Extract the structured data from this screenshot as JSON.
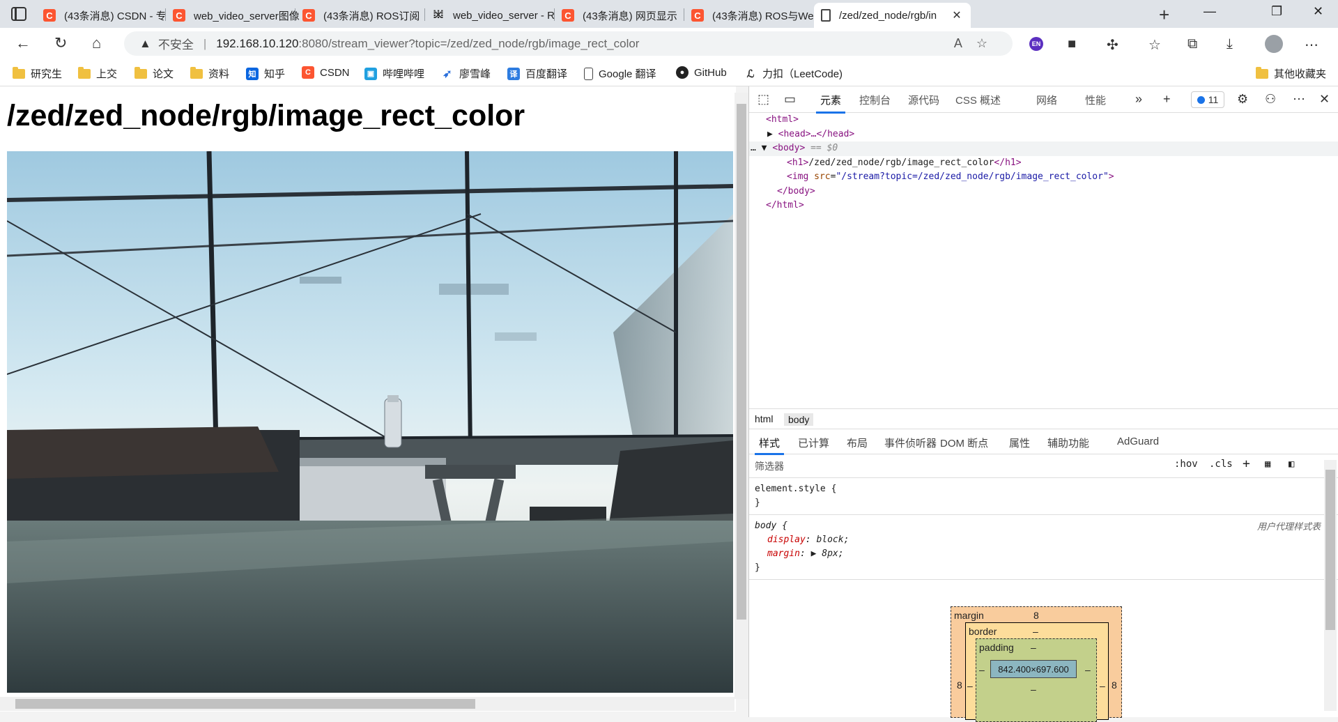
{
  "tabs": [
    {
      "favicon": "csdn-icon",
      "fav_text": "C",
      "title": "(43条消息) CSDN - 专"
    },
    {
      "favicon": "csdn-icon",
      "fav_text": "C",
      "title": "web_video_server图像"
    },
    {
      "favicon": "csdn-icon",
      "fav_text": "C",
      "title": "(43条消息) ROS订阅"
    },
    {
      "favicon": "grid-icon",
      "fav_text": "⁞⁞⁞",
      "title": "web_video_server - R"
    },
    {
      "favicon": "csdn-icon",
      "fav_text": "C",
      "title": "(43条消息) 网页显示"
    },
    {
      "favicon": "csdn-icon",
      "fav_text": "C",
      "title": "(43条消息) ROS与We"
    },
    {
      "favicon": "document-icon",
      "fav_text": "",
      "title": "/zed/zed_node/rgb/in"
    }
  ],
  "address": {
    "security": "不安全",
    "host": "192.168.10.120",
    "path": ":8080/stream_viewer?topic=/zed/zed_node/rgb/image_rect_color"
  },
  "bookmarks": [
    {
      "icon": "folder-icon",
      "label": "研究生"
    },
    {
      "icon": "folder-icon",
      "label": "上交"
    },
    {
      "icon": "folder-icon",
      "label": "论文"
    },
    {
      "icon": "folder-icon",
      "label": "资料"
    },
    {
      "icon": "zhihu-icon",
      "label": "知乎"
    },
    {
      "icon": "csdn-icon",
      "label": "CSDN"
    },
    {
      "icon": "bilibili-icon",
      "label": "哔哩哔哩"
    },
    {
      "icon": "rocket-icon",
      "label": "廖雪峰"
    },
    {
      "icon": "translate-icon",
      "label": "百度翻译"
    },
    {
      "icon": "page-icon",
      "label": "Google 翻译"
    },
    {
      "icon": "github-icon",
      "label": "GitHub"
    },
    {
      "icon": "leetcode-icon",
      "label": "力扣（LeetCode)"
    },
    {
      "icon": "folder-icon",
      "label": "其他收藏夹"
    }
  ],
  "page": {
    "heading": "/zed/zed_node/rgb/image_rect_color"
  },
  "devtools": {
    "tabs": [
      "元素",
      "控制台",
      "源代码",
      "CSS 概述",
      "网络",
      "性能"
    ],
    "issues_count": "11",
    "dom": {
      "html_open": "<html>",
      "head": "<head>…</head>",
      "body_open": "<body>",
      "body_marker": "== $0",
      "h1_open": "<h1>",
      "h1_text": "/zed/zed_node/rgb/image_rect_color",
      "h1_close": "</h1>",
      "img_tag": "<img",
      "img_attr": "src",
      "img_value": "\"/stream?topic=/zed/zed_node/rgb/image_rect_color\"",
      "img_end": ">",
      "body_close": "</body>",
      "html_close": "</html>"
    },
    "breadcrumb": [
      "html",
      "body"
    ],
    "style_tabs": [
      "样式",
      "已计算",
      "布局",
      "事件侦听器",
      "DOM 断点",
      "属性",
      "辅助功能",
      "AdGuard"
    ],
    "filter_placeholder": "筛选器",
    "filter_buttons": [
      ":hov",
      ".cls"
    ],
    "element_style": "element.style {",
    "brace_close": "}",
    "body_rule": {
      "selector": "body {",
      "source": "用户代理样式表",
      "props": [
        {
          "name": "display",
          "value": "block;"
        },
        {
          "name": "margin",
          "value": "▶ 8px;"
        }
      ]
    },
    "box_model": {
      "margin_label": "margin",
      "margin_value": "8",
      "border_label": "border",
      "border_value": "–",
      "padding_label": "padding",
      "padding_value": "–",
      "content": "842.400×697.600",
      "side_left": "8",
      "side_right": "8",
      "dash": "–"
    }
  }
}
